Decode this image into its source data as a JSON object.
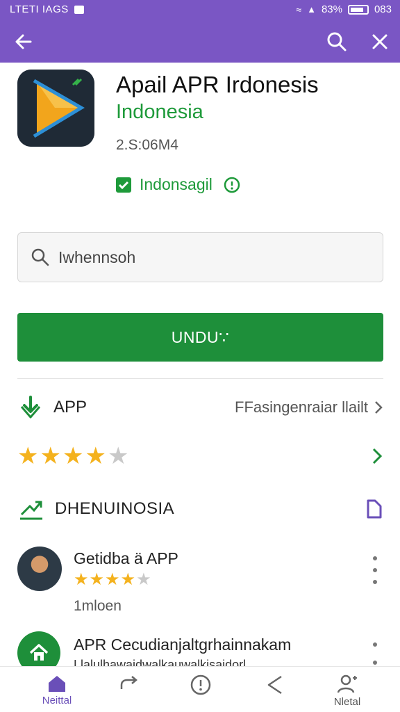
{
  "status_bar": {
    "carrier": "LTETI IAGS",
    "battery": "83%",
    "time": "083"
  },
  "header": {
    "back_icon": "arrow-left-icon",
    "search_icon": "search-icon",
    "close_icon": "close-icon"
  },
  "app": {
    "title": "Apail APR Irdonesis",
    "subtitle": "Indonesia",
    "date": "2.S:06M4",
    "badge": "Indonsagil"
  },
  "search": {
    "value": "Iwhennsoh",
    "placeholder": ""
  },
  "install_label": "UNDU∵",
  "app_row": {
    "label": "APP",
    "right": "FFasingenraiar llailt"
  },
  "rating": {
    "value": 4,
    "max": 5
  },
  "developer": {
    "label": "DHENUINOSIA"
  },
  "reviews": [
    {
      "title": "Getidba ä APP",
      "stars": 4,
      "max": 5,
      "meta": "1mloen"
    },
    {
      "title": "APR Cecudianjaltgrhainnakam",
      "sub": "Llalulhawaidwalkauwalkisaidorl"
    }
  ],
  "bottom_nav": [
    {
      "label": "Neittal",
      "icon": "home-icon",
      "active": true
    },
    {
      "label": "",
      "icon": "redo-icon"
    },
    {
      "label": "",
      "icon": "info-icon"
    },
    {
      "label": "",
      "icon": "back-triangle-icon"
    },
    {
      "label": "Nletal",
      "icon": "person-icon"
    }
  ],
  "colors": {
    "primary": "#7a56c4",
    "green": "#1e8f3a",
    "star": "#f4b21e"
  }
}
